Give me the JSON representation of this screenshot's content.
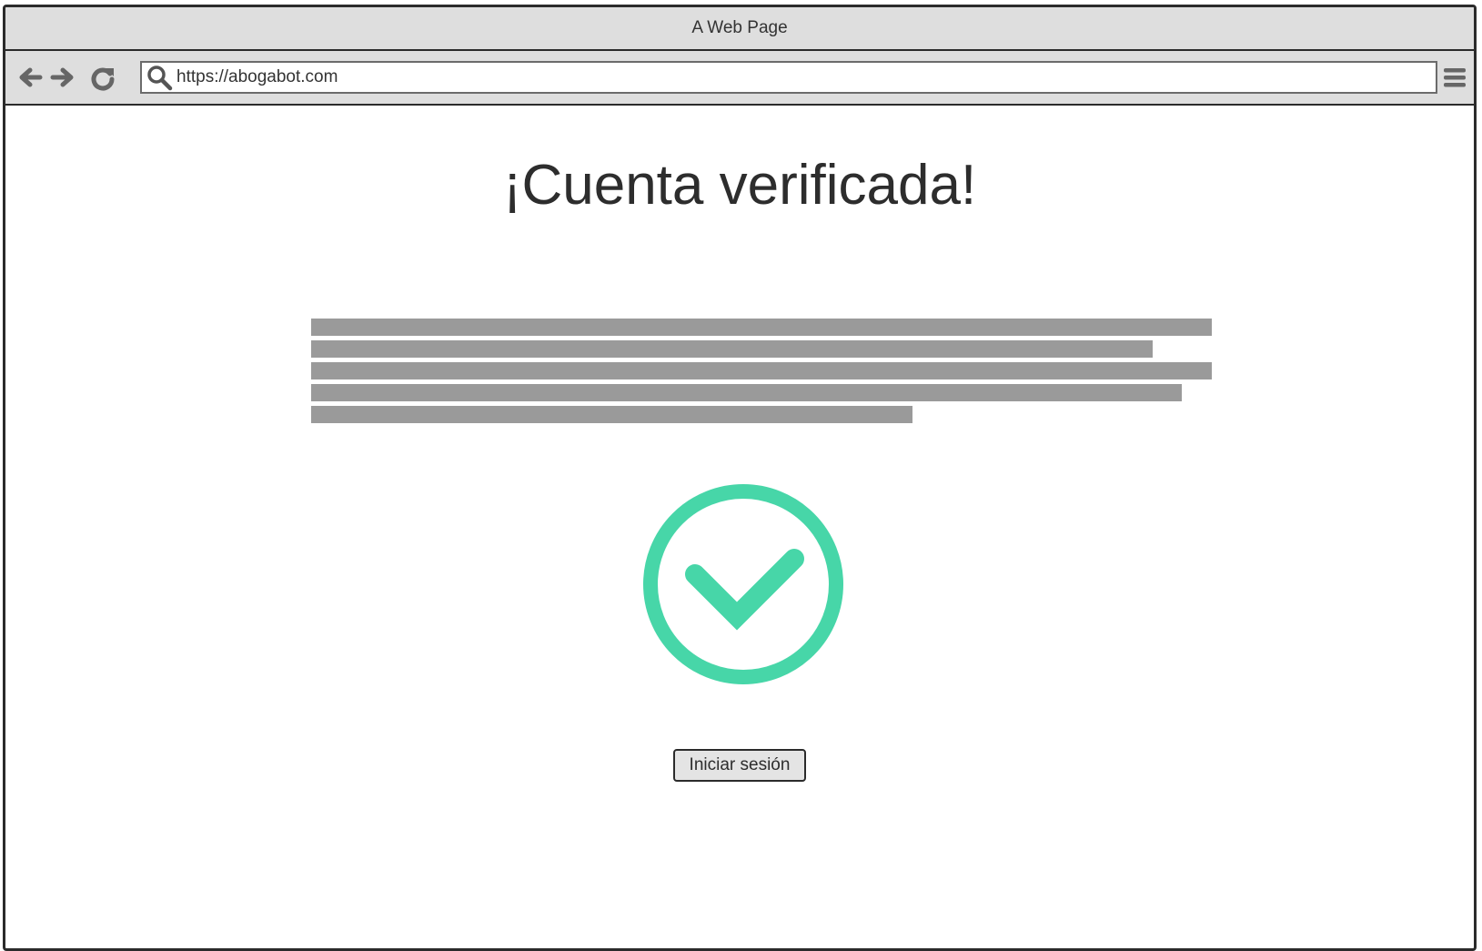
{
  "window": {
    "title": "A Web Page"
  },
  "toolbar": {
    "url": "https://abogabot.com",
    "icons": [
      "back-arrow-icon",
      "forward-arrow-icon",
      "refresh-icon",
      "search-icon",
      "menu-icon"
    ]
  },
  "main": {
    "heading": "¡Cuenta verificada!",
    "text_placeholder_lines": [
      1.0,
      0.934,
      1.0,
      0.967,
      0.668
    ],
    "status_icon": "checkmark-circle-icon",
    "login_button": "Iniciar sesión"
  },
  "colors": {
    "accent": "#47d6a8",
    "chrome": "#dedede",
    "placeholder": "#9a9a9a",
    "border": "#2b2b2b"
  }
}
